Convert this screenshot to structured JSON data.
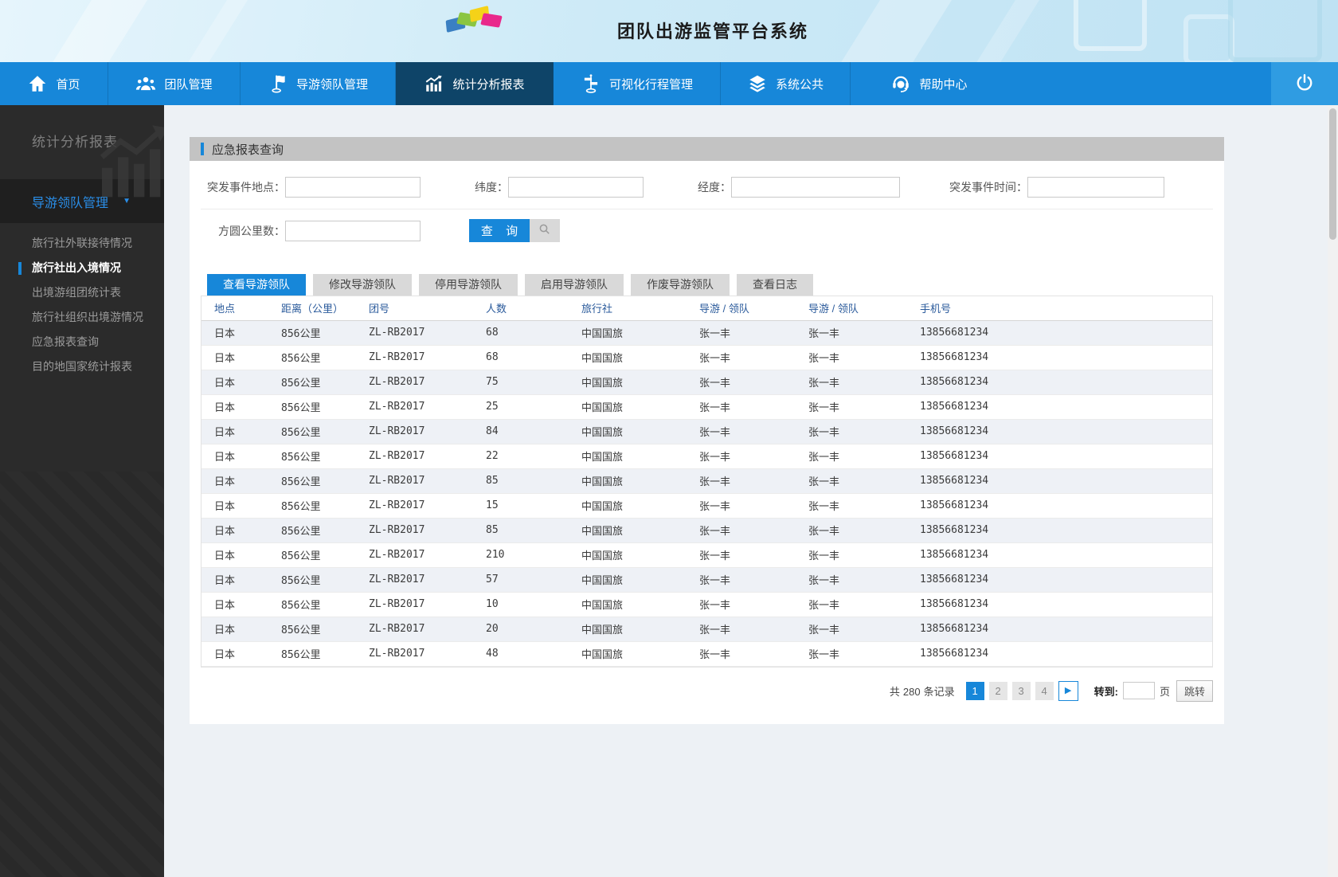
{
  "header": {
    "title": "团队出游监管平台系统"
  },
  "nav": {
    "items": [
      {
        "name": "home",
        "label": "首页",
        "icon": "home-icon",
        "active": false
      },
      {
        "name": "team-management",
        "label": "团队管理",
        "icon": "team-icon",
        "active": false
      },
      {
        "name": "guide-management",
        "label": "导游领队管理",
        "icon": "flag-icon",
        "active": false
      },
      {
        "name": "statistics-reports",
        "label": "统计分析报表",
        "icon": "bar-chart-icon",
        "active": true
      },
      {
        "name": "visual-itinerary",
        "label": "可视化行程管理",
        "icon": "signpost-icon",
        "active": false
      },
      {
        "name": "system-public",
        "label": "系统公共",
        "icon": "layers-icon",
        "active": false
      },
      {
        "name": "help-center",
        "label": "帮助中心",
        "icon": "headset-icon",
        "active": false
      }
    ],
    "logout_icon": "power-icon"
  },
  "sidebar": {
    "title": "统计分析报表",
    "group": {
      "label": "导游领队管理",
      "expanded": true,
      "icon": "chevron-down-icon"
    },
    "items": [
      {
        "name": "agency-reception-status",
        "label": "旅行社外联接待情况",
        "active": false
      },
      {
        "name": "agency-entry-exit-status",
        "label": "旅行社出入境情况",
        "active": true
      },
      {
        "name": "outbound-group-stats",
        "label": "出境游组团统计表",
        "active": false
      },
      {
        "name": "agency-outbound-status",
        "label": "旅行社组织出境游情况",
        "active": false
      },
      {
        "name": "emergency-report-query",
        "label": "应急报表查询",
        "active": false
      },
      {
        "name": "destination-country-stats",
        "label": "目的地国家统计报表",
        "active": false
      }
    ]
  },
  "panel": {
    "title": "应急报表查询",
    "form": {
      "fields": [
        {
          "name": "incident-location",
          "label": "突发事件地点：",
          "value": ""
        },
        {
          "name": "latitude",
          "label": "纬度：",
          "value": ""
        },
        {
          "name": "longitude",
          "label": "经度：",
          "value": ""
        },
        {
          "name": "incident-time",
          "label": "突发事件时间：",
          "value": ""
        },
        {
          "name": "radius-km",
          "label": "方圆公里数：",
          "value": ""
        }
      ],
      "query_button": "查 询",
      "search_icon": "search-icon"
    },
    "tabs": [
      {
        "name": "view-guide",
        "label": "查看导游领队",
        "active": true
      },
      {
        "name": "modify-guide",
        "label": "修改导游领队",
        "active": false
      },
      {
        "name": "disable-guide",
        "label": "停用导游领队",
        "active": false
      },
      {
        "name": "enable-guide",
        "label": "启用导游领队",
        "active": false
      },
      {
        "name": "void-guide",
        "label": "作废导游领队",
        "active": false
      },
      {
        "name": "view-log",
        "label": "查看日志",
        "active": false
      }
    ],
    "table": {
      "columns": [
        "地点",
        "距离（公里）",
        "团号",
        "人数",
        "旅行社",
        "导游 / 领队",
        "导游 / 领队",
        "手机号"
      ],
      "rows": [
        [
          "日本",
          "856公里",
          "ZL-RB2017",
          "68",
          "中国国旅",
          "张一丰",
          "张一丰",
          "13856681234"
        ],
        [
          "日本",
          "856公里",
          "ZL-RB2017",
          "68",
          "中国国旅",
          "张一丰",
          "张一丰",
          "13856681234"
        ],
        [
          "日本",
          "856公里",
          "ZL-RB2017",
          "75",
          "中国国旅",
          "张一丰",
          "张一丰",
          "13856681234"
        ],
        [
          "日本",
          "856公里",
          "ZL-RB2017",
          "25",
          "中国国旅",
          "张一丰",
          "张一丰",
          "13856681234"
        ],
        [
          "日本",
          "856公里",
          "ZL-RB2017",
          "84",
          "中国国旅",
          "张一丰",
          "张一丰",
          "13856681234"
        ],
        [
          "日本",
          "856公里",
          "ZL-RB2017",
          "22",
          "中国国旅",
          "张一丰",
          "张一丰",
          "13856681234"
        ],
        [
          "日本",
          "856公里",
          "ZL-RB2017",
          "85",
          "中国国旅",
          "张一丰",
          "张一丰",
          "13856681234"
        ],
        [
          "日本",
          "856公里",
          "ZL-RB2017",
          "15",
          "中国国旅",
          "张一丰",
          "张一丰",
          "13856681234"
        ],
        [
          "日本",
          "856公里",
          "ZL-RB2017",
          "85",
          "中国国旅",
          "张一丰",
          "张一丰",
          "13856681234"
        ],
        [
          "日本",
          "856公里",
          "ZL-RB2017",
          "210",
          "中国国旅",
          "张一丰",
          "张一丰",
          "13856681234"
        ],
        [
          "日本",
          "856公里",
          "ZL-RB2017",
          "57",
          "中国国旅",
          "张一丰",
          "张一丰",
          "13856681234"
        ],
        [
          "日本",
          "856公里",
          "ZL-RB2017",
          "10",
          "中国国旅",
          "张一丰",
          "张一丰",
          "13856681234"
        ],
        [
          "日本",
          "856公里",
          "ZL-RB2017",
          "20",
          "中国国旅",
          "张一丰",
          "张一丰",
          "13856681234"
        ],
        [
          "日本",
          "856公里",
          "ZL-RB2017",
          "48",
          "中国国旅",
          "张一丰",
          "张一丰",
          "13856681234"
        ]
      ]
    },
    "pagination": {
      "records_prefix": "共",
      "records_count": "280",
      "records_suffix": "条记录",
      "pages": [
        "1",
        "2",
        "3",
        "4"
      ],
      "active_page": "1",
      "next_icon": "next-page-icon",
      "goto_label": "转到:",
      "goto_value": "",
      "page_unit": "页",
      "jump_label": "跳转"
    }
  },
  "colors": {
    "accent": "#1787d9",
    "nav_active": "#0e4468",
    "sidebar_link": "#2a8ee8",
    "table_header_text": "#2a5a9b",
    "row_stripe": "#eef1f6",
    "panel_header_bg": "#c3c3c3"
  }
}
